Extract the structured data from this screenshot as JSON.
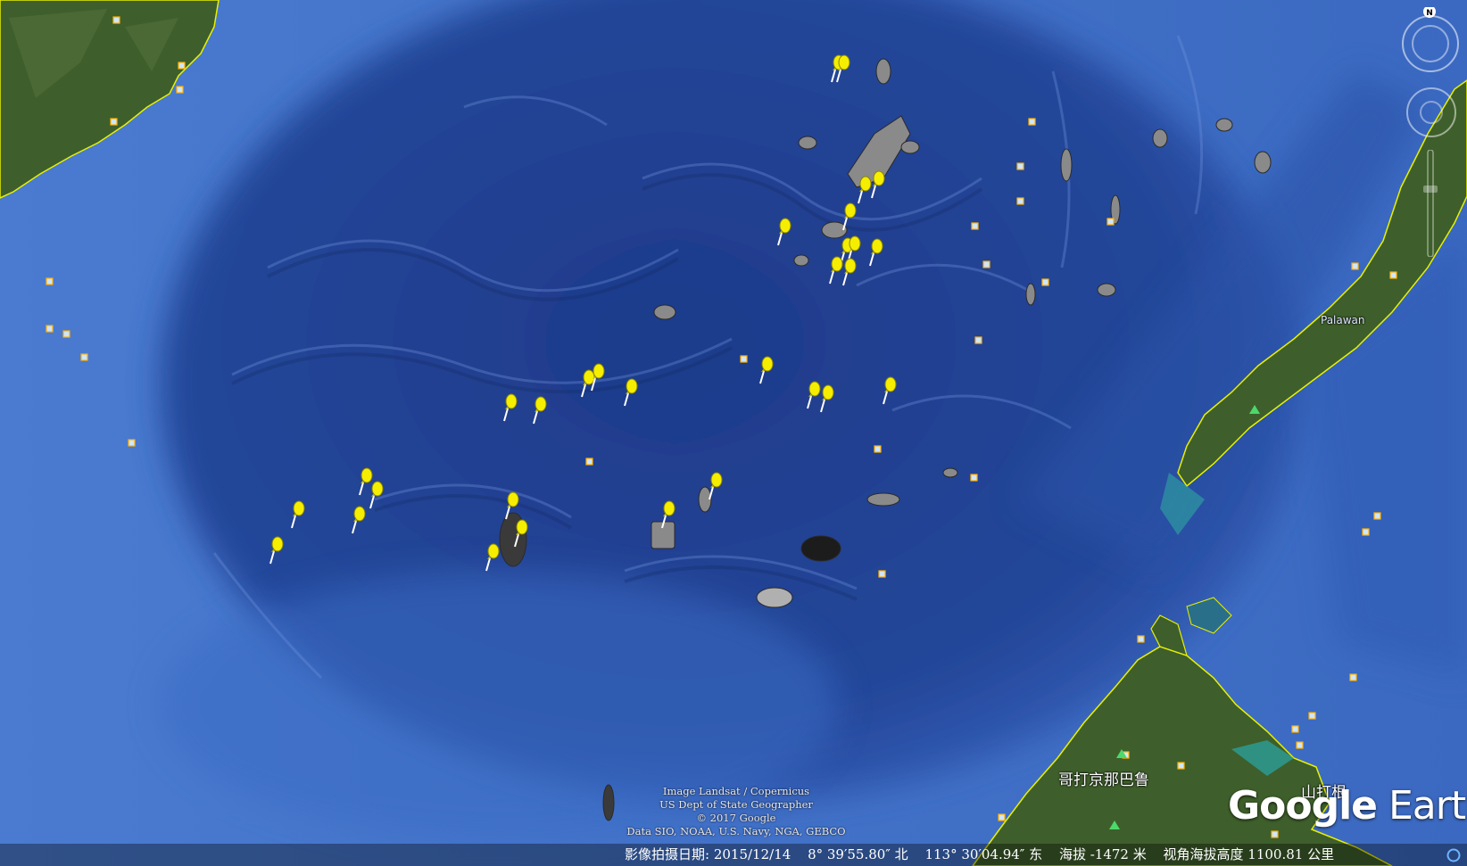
{
  "map": {
    "labels": {
      "palawan": "Palawan",
      "kota_kinabalu": "哥打京那巴鲁",
      "sandakan": "山打根"
    },
    "colors": {
      "ocean_deep": "#1f3f90",
      "ocean_shelf": "#3d6fc8",
      "ocean_light": "#5b8ad6",
      "land": "#3d5e2a",
      "coastline": "#e8f000",
      "pin": "#f5ee00"
    }
  },
  "attribution": {
    "line1": "Image Landsat / Copernicus",
    "line2": "US Dept of State Geographer",
    "line3": "© 2017 Google",
    "line4": "Data SIO, NOAA, U.S. Navy, NGA, GEBCO"
  },
  "logo": {
    "google": "Google",
    "earth": "Earth"
  },
  "status_bar": {
    "imagery_date": "影像拍摄日期: 2015/12/14",
    "latitude": "8° 39′55.80″ 北",
    "longitude": "113° 30′04.94″ 东",
    "elevation": "海拔 -1472 米",
    "eye_altitude": "视角海拔高度 1100.81 公里"
  },
  "controls": {
    "compass_north": "N",
    "icons": [
      "compass-icon",
      "look-joystick-icon",
      "zoom-slider-icon",
      "status-indicator-icon"
    ]
  }
}
